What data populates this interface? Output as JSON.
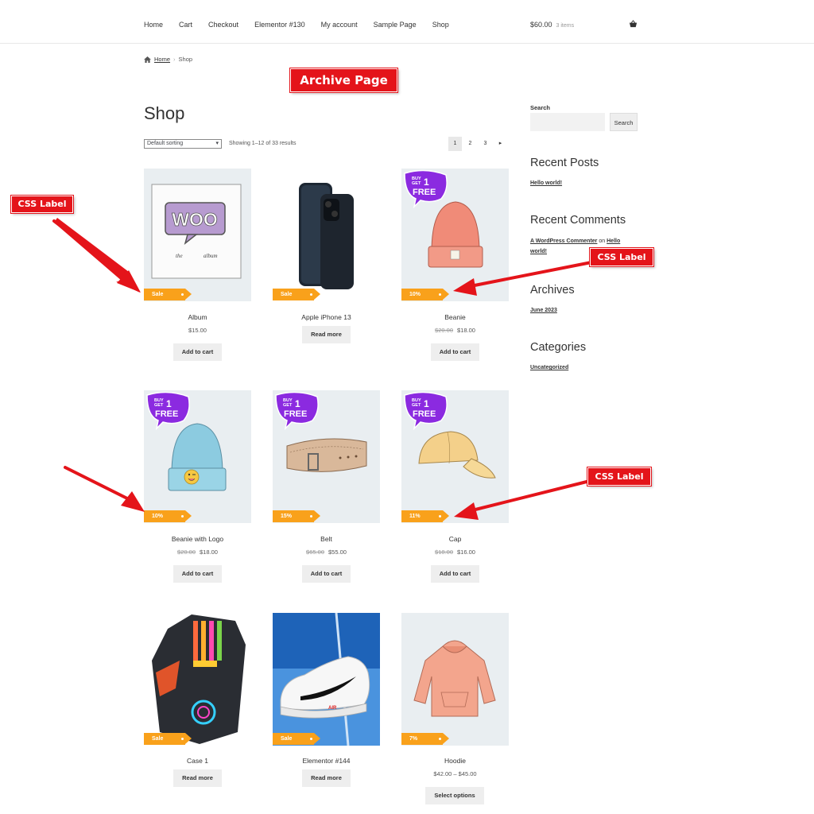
{
  "nav": {
    "items": [
      "Home",
      "Cart",
      "Checkout",
      "Elementor #130",
      "My account",
      "Sample Page",
      "Shop"
    ]
  },
  "cart": {
    "total": "$60.00",
    "count": "3 items"
  },
  "breadcrumb": {
    "home": "Home",
    "current": "Shop"
  },
  "annotations": {
    "archive": "Archive Page",
    "css_label": "CSS Label"
  },
  "shop": {
    "title": "Shop",
    "sort_value": "Default sorting",
    "result_count": "Showing 1–12 of 33 results",
    "pages": [
      "1",
      "2",
      "3"
    ]
  },
  "products": [
    {
      "name": "Album",
      "price": "$15.00",
      "old_price": "",
      "button": "Add to cart",
      "tag": "Sale"
    },
    {
      "name": "Apple iPhone 13",
      "price": "",
      "old_price": "",
      "button": "Read more",
      "tag": "Sale"
    },
    {
      "name": "Beanie",
      "price": "$18.00",
      "old_price": "$20.00",
      "button": "Add to cart",
      "tag": "10%",
      "promo": [
        "BUY",
        "GET",
        "1",
        "FREE"
      ]
    },
    {
      "name": "Beanie with Logo",
      "price": "$18.00",
      "old_price": "$20.00",
      "button": "Add to cart",
      "tag": "10%",
      "promo": [
        "BUY",
        "GET",
        "1",
        "FREE"
      ]
    },
    {
      "name": "Belt",
      "price": "$55.00",
      "old_price": "$65.00",
      "button": "Add to cart",
      "tag": "15%",
      "promo": [
        "BUY",
        "GET",
        "1",
        "FREE"
      ]
    },
    {
      "name": "Cap",
      "price": "$16.00",
      "old_price": "$18.00",
      "button": "Add to cart",
      "tag": "11%",
      "promo": [
        "BUY",
        "GET",
        "1",
        "FREE"
      ]
    },
    {
      "name": "Case 1",
      "price": "",
      "old_price": "",
      "button": "Read more",
      "tag": "Sale"
    },
    {
      "name": "Elementor #144",
      "price": "",
      "old_price": "",
      "button": "Read more",
      "tag": "Sale"
    },
    {
      "name": "Hoodie",
      "price": "$42.00 – $45.00",
      "old_price": "",
      "button": "Select options",
      "tag": "7%"
    }
  ],
  "album_art": {
    "logo": "WOO",
    "caption_left": "the",
    "caption_right": "album"
  },
  "shoe_text": "AIR",
  "sidebar": {
    "search_label": "Search",
    "search_button": "Search",
    "recent_posts_title": "Recent Posts",
    "recent_post": "Hello world!",
    "recent_comments_title": "Recent Comments",
    "comment_author": "A WordPress Commenter",
    "comment_on": "on",
    "comment_post": "Hello world!",
    "archives_title": "Archives",
    "archive_item": "June 2023",
    "categories_title": "Categories",
    "category_item": "Uncategorized"
  },
  "colors": {
    "annotation": "#e4141a",
    "tag": "#f9a11b",
    "promo": "#8b2ae0"
  }
}
